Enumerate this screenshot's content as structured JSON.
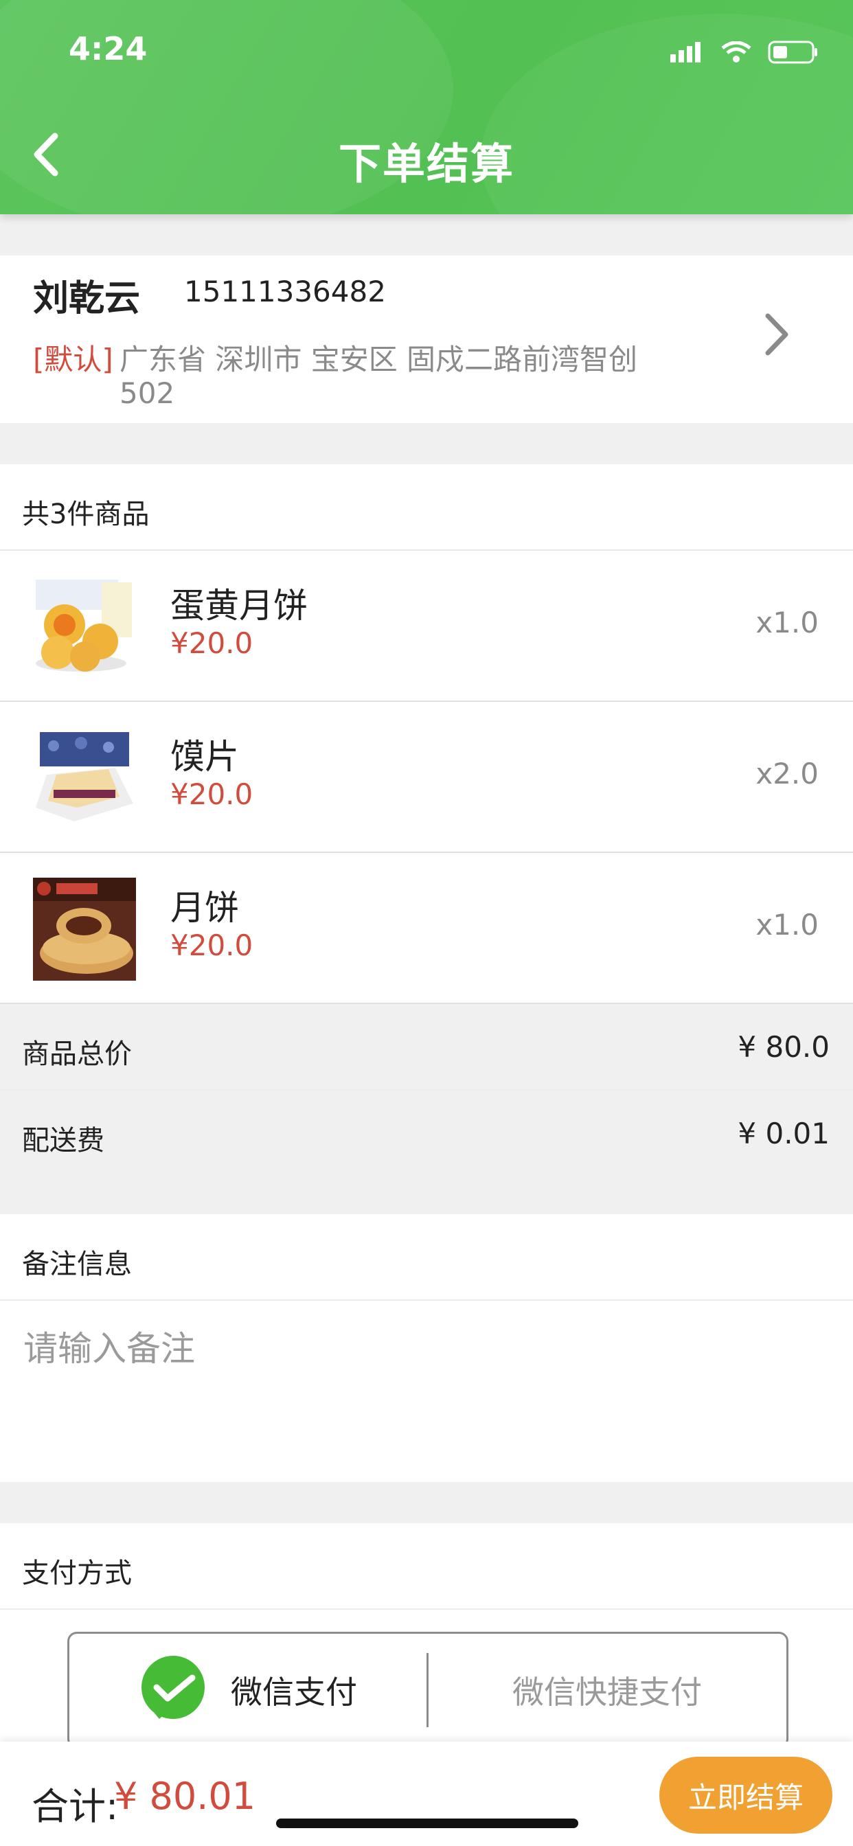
{
  "status_bar": {
    "time": "4:24"
  },
  "header": {
    "title": "下单结算"
  },
  "address": {
    "name": "刘乾云",
    "phone": "15111336482",
    "default_tag": "[默认]",
    "line1": "广东省 深圳市 宝安区 固戍二路前湾智创",
    "line2": "502"
  },
  "items": {
    "count_label": "共3件商品",
    "products": [
      {
        "name": "蛋黄月饼",
        "price": "¥20.0",
        "qty": "x1.0"
      },
      {
        "name": "馍片",
        "price": "¥20.0",
        "qty": "x2.0"
      },
      {
        "name": "月饼",
        "price": "¥20.0",
        "qty": "x1.0"
      }
    ],
    "subtotal_label": "商品总价",
    "subtotal_value": "¥ 80.0",
    "delivery_label": "配送费",
    "delivery_value": "¥ 0.01"
  },
  "remark": {
    "label": "备注信息",
    "placeholder": "请输入备注",
    "value": ""
  },
  "payment": {
    "label": "支付方式",
    "options": [
      "微信支付",
      "微信快捷支付"
    ]
  },
  "footer": {
    "total_label": "合计:",
    "total_value": "¥ 80.01",
    "checkout_label": "立即结算"
  },
  "colors": {
    "header_green": "#52c052",
    "price_red": "#d14c3c",
    "checkout_orange": "#f1a032",
    "wechat_green": "#46bb36"
  }
}
